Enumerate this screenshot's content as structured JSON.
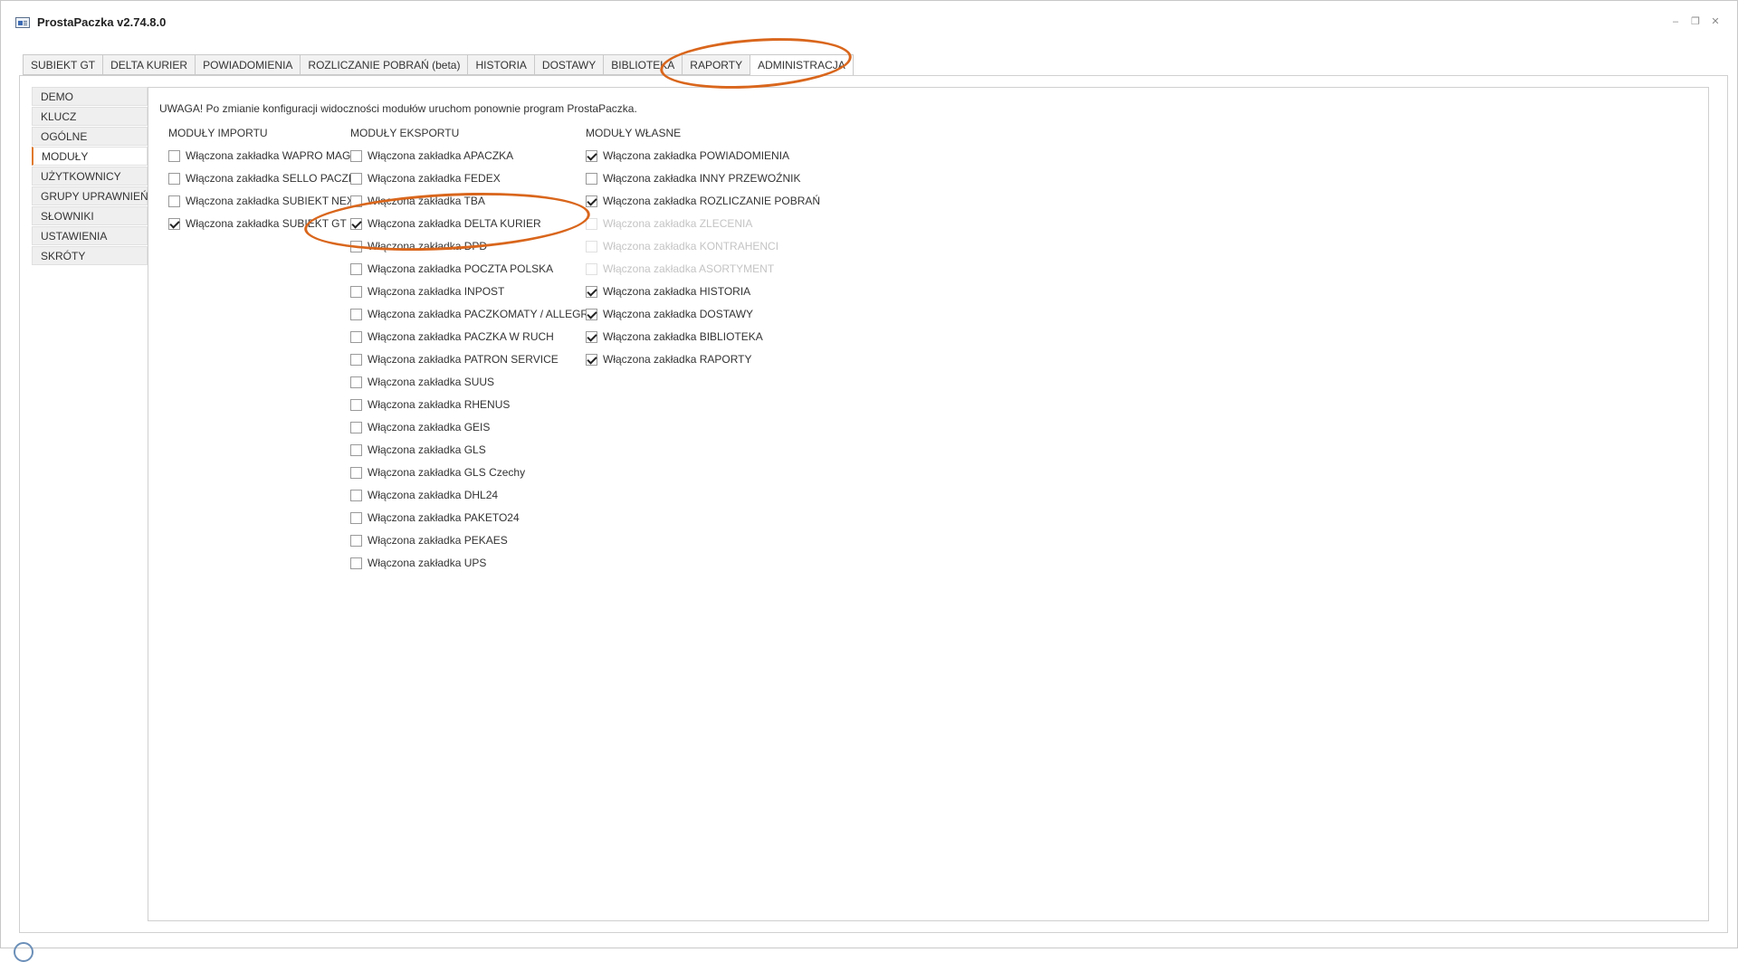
{
  "window": {
    "title": "ProstaPaczka v2.74.8.0"
  },
  "tabs": [
    {
      "label": "SUBIEKT GT"
    },
    {
      "label": "DELTA KURIER"
    },
    {
      "label": "POWIADOMIENIA"
    },
    {
      "label": "ROZLICZANIE POBRAŃ (beta)"
    },
    {
      "label": "HISTORIA"
    },
    {
      "label": "DOSTAWY"
    },
    {
      "label": "BIBLIOTEKA"
    },
    {
      "label": "RAPORTY"
    },
    {
      "label": "ADMINISTRACJA",
      "active": true
    }
  ],
  "sidenav": [
    {
      "label": "DEMO"
    },
    {
      "label": "KLUCZ"
    },
    {
      "label": "OGÓLNE"
    },
    {
      "label": "MODUŁY",
      "active": true
    },
    {
      "label": "UŻYTKOWNICY"
    },
    {
      "label": "GRUPY UPRAWNIEŃ"
    },
    {
      "label": "SŁOWNIKI"
    },
    {
      "label": "USTAWIENIA"
    },
    {
      "label": "SKRÓTY"
    }
  ],
  "warning": "UWAGA! Po zmianie konfiguracji widoczności modułów uruchom ponownie program ProstaPaczka.",
  "columns": {
    "import": {
      "header": "MODUŁY IMPORTU",
      "items": [
        {
          "label": "Włączona zakładka WAPRO MAG",
          "checked": false
        },
        {
          "label": "Włączona zakładka SELLO PACZKI",
          "checked": false
        },
        {
          "label": "Włączona zakładka SUBIEKT NEXO",
          "checked": false
        },
        {
          "label": "Włączona zakładka SUBIEKT GT",
          "checked": true
        }
      ]
    },
    "export": {
      "header": "MODUŁY EKSPORTU",
      "items": [
        {
          "label": "Włączona zakładka APACZKA",
          "checked": false
        },
        {
          "label": "Włączona zakładka FEDEX",
          "checked": false
        },
        {
          "label": "Włączona zakładka TBA",
          "checked": false
        },
        {
          "label": "Włączona zakładka DELTA KURIER",
          "checked": true
        },
        {
          "label": "Włączona zakładka DPD",
          "checked": false
        },
        {
          "label": "Włączona zakładka POCZTA POLSKA",
          "checked": false
        },
        {
          "label": "Włączona zakładka INPOST",
          "checked": false
        },
        {
          "label": "Włączona zakładka PACZKOMATY / ALLEGRO",
          "checked": false
        },
        {
          "label": "Włączona zakładka PACZKA W RUCH",
          "checked": false
        },
        {
          "label": "Włączona zakładka PATRON SERVICE",
          "checked": false
        },
        {
          "label": "Włączona zakładka SUUS",
          "checked": false
        },
        {
          "label": "Włączona zakładka RHENUS",
          "checked": false
        },
        {
          "label": "Włączona zakładka GEIS",
          "checked": false
        },
        {
          "label": "Włączona zakładka GLS",
          "checked": false
        },
        {
          "label": "Włączona zakładka GLS Czechy",
          "checked": false
        },
        {
          "label": "Włączona zakładka DHL24",
          "checked": false
        },
        {
          "label": "Włączona zakładka PAKETO24",
          "checked": false
        },
        {
          "label": "Włączona zakładka PEKAES",
          "checked": false
        },
        {
          "label": "Włączona zakładka UPS",
          "checked": false
        }
      ]
    },
    "own": {
      "header": "MODUŁY WŁASNE",
      "items": [
        {
          "label": "Włączona zakładka POWIADOMIENIA",
          "checked": true
        },
        {
          "label": "Włączona zakładka INNY PRZEWOŹNIK",
          "checked": false
        },
        {
          "label": "Włączona zakładka ROZLICZANIE POBRAŃ",
          "checked": true
        },
        {
          "label": "Włączona zakładka ZLECENIA",
          "checked": false,
          "disabled": true
        },
        {
          "label": "Włączona zakładka KONTRAHENCI",
          "checked": false,
          "disabled": true
        },
        {
          "label": "Włączona zakładka ASORTYMENT",
          "checked": false,
          "disabled": true
        },
        {
          "label": "Włączona zakładka HISTORIA",
          "checked": true
        },
        {
          "label": "Włączona zakładka DOSTAWY",
          "checked": true
        },
        {
          "label": "Włączona zakładka BIBLIOTEKA",
          "checked": true
        },
        {
          "label": "Włączona zakładka RAPORTY",
          "checked": true
        }
      ]
    }
  },
  "colors": {
    "accent": "#d9661c",
    "border": "#cfcfcf"
  }
}
